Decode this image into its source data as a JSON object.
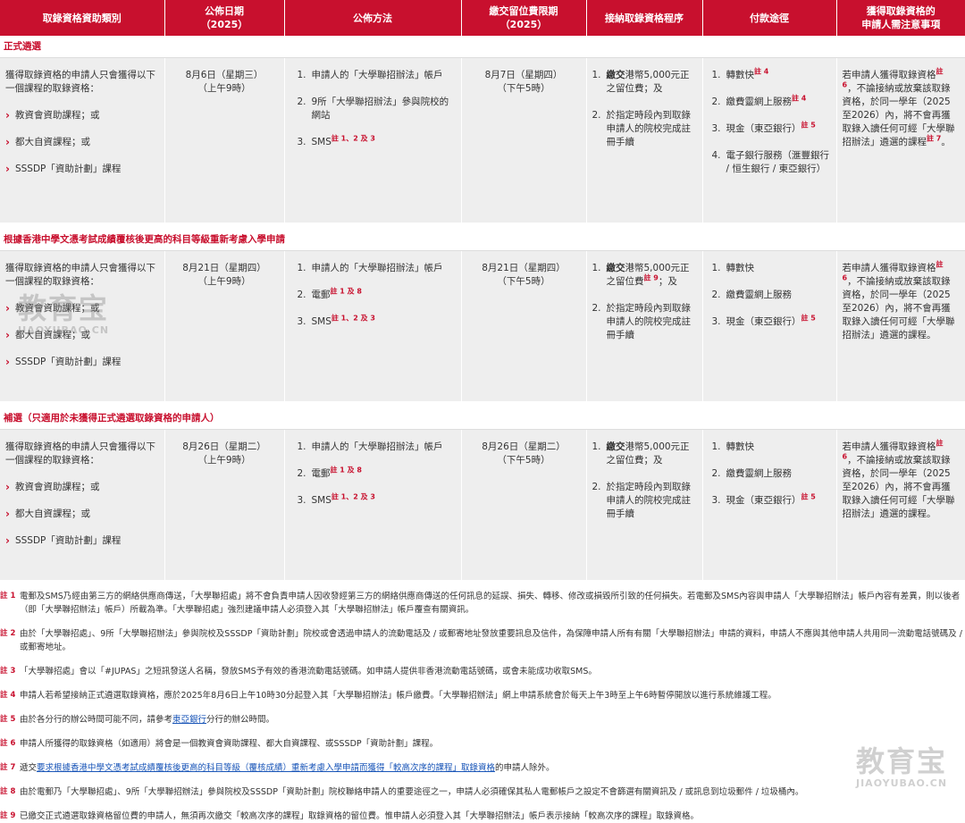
{
  "headers": [
    "取錄資格資助類別",
    "公佈日期\n（2025）",
    "公佈方法",
    "繳交留位費限期\n（2025）",
    "接納取錄資格程序",
    "付款途徑",
    "獲得取錄資格的\n申請人需注意事項"
  ],
  "sections": [
    {
      "title": "正式遴選",
      "eligibility_intro": "獲得取錄資格的申請人只會獲得以下一個課程的取錄資格：",
      "eligibility_items": [
        "教資會資助課程；或",
        "都大自資課程；或",
        "SSSDP「資助計劃」課程"
      ],
      "announce_date": "8月6日（星期三）",
      "announce_time": "（上午9時）",
      "methods": [
        {
          "text": "申請人的「大學聯招辦法」帳戶",
          "note": ""
        },
        {
          "text": "9所「大學聯招辦法」參與院校的網站",
          "note": ""
        },
        {
          "text": "SMS",
          "note": "註 1、2 及 3"
        }
      ],
      "deadline_date": "8月7日（星期四）",
      "deadline_time": "（下午5時）",
      "accept_steps": [
        {
          "pre": "繳交",
          "mid": "港幣5,000元正之留位費",
          "note": "",
          "post": "；及"
        },
        {
          "pre": "",
          "mid": "於指定時段內到取錄申請人的院校完成註冊手續",
          "note": "",
          "post": ""
        }
      ],
      "payments": [
        {
          "text": "轉數快",
          "note": "註 4"
        },
        {
          "text": "繳費靈網上服務",
          "note": "註 4"
        },
        {
          "text": "現金（東亞銀行）",
          "note": "註 5"
        },
        {
          "text": "電子銀行服務（滙豐銀行 / 恒生銀行 / 東亞銀行）",
          "note": ""
        }
      ],
      "notice_a": "若申請人獲得取錄資格",
      "notice_note1": "註 6",
      "notice_b": "，不論接納或放棄該取錄資格，於同一學年（2025至2026）內，將不會再獲取錄入讀任何可經「大學聯招辦法」遴選的課程",
      "notice_note2": "註 7",
      "notice_c": "。"
    },
    {
      "title": "根據香港中學文憑考試成績覆核後更高的科目等級重新考慮入學申請",
      "eligibility_intro": "獲得取錄資格的申請人只會獲得以下一個課程的取錄資格：",
      "eligibility_items": [
        "教資會資助課程；或",
        "都大自資課程；或",
        "SSSDP「資助計劃」課程"
      ],
      "announce_date": "8月21日（星期四）",
      "announce_time": "（上午9時）",
      "methods": [
        {
          "text": "申請人的「大學聯招辦法」帳戶",
          "note": ""
        },
        {
          "text": "電郵",
          "note": "註 1 及 8"
        },
        {
          "text": "SMS",
          "note": "註 1、2 及 3"
        }
      ],
      "deadline_date": "8月21日（星期四）",
      "deadline_time": "（下午5時）",
      "accept_steps": [
        {
          "pre": "繳交",
          "mid": "港幣5,000元正之留位費",
          "note": "註 9",
          "post": "；及"
        },
        {
          "pre": "",
          "mid": "於指定時段內到取錄申請人的院校完成註冊手續",
          "note": "",
          "post": ""
        }
      ],
      "payments": [
        {
          "text": "轉數快",
          "note": ""
        },
        {
          "text": "繳費靈網上服務",
          "note": ""
        },
        {
          "text": "現金（東亞銀行）",
          "note": "註 5"
        }
      ],
      "notice_a": "若申請人獲得取錄資格",
      "notice_note1": "註 6",
      "notice_b": "，不論接納或放棄該取錄資格，於同一學年（2025至2026）內，將不會再獲取錄入讀任何可經「大學聯招辦法」遴選的課程。",
      "notice_note2": "",
      "notice_c": ""
    },
    {
      "title": "補選（只適用於未獲得正式遴選取錄資格的申請人）",
      "eligibility_intro": "獲得取錄資格的申請人只會獲得以下一個課程的取錄資格：",
      "eligibility_items": [
        "教資會資助課程；或",
        "都大自資課程；或",
        "SSSDP「資助計劃」課程"
      ],
      "announce_date": "8月26日（星期二）",
      "announce_time": "（上午9時）",
      "methods": [
        {
          "text": "申請人的「大學聯招辦法」帳戶",
          "note": ""
        },
        {
          "text": "電郵",
          "note": "註 1 及 8"
        },
        {
          "text": "SMS",
          "note": "註 1、2 及 3"
        }
      ],
      "deadline_date": "8月26日（星期二）",
      "deadline_time": "（下午5時）",
      "accept_steps": [
        {
          "pre": "繳交",
          "mid": "港幣5,000元正之留位費",
          "note": "",
          "post": "；及"
        },
        {
          "pre": "",
          "mid": "於指定時段內到取錄申請人的院校完成註冊手續",
          "note": "",
          "post": ""
        }
      ],
      "payments": [
        {
          "text": "轉數快",
          "note": ""
        },
        {
          "text": "繳費靈網上服務",
          "note": ""
        },
        {
          "text": "現金（東亞銀行）",
          "note": "註 5"
        }
      ],
      "notice_a": "若申請人獲得取錄資格",
      "notice_note1": "註 6",
      "notice_b": "，不論接納或放棄該取錄資格，於同一學年（2025至2026）內，將不會再獲取錄入讀任何可經「大學聯招辦法」遴選的課程。",
      "notice_note2": "",
      "notice_c": ""
    }
  ],
  "notes": [
    {
      "label": "註 1",
      "text": "電郵及SMS乃經由第三方的網絡供應商傳送，「大學聯招處」將不會負責申請人因收發經第三方的網絡供應商傳送的任何訊息的延誤、損失、轉移、修改或損毀所引致的任何損失。若電郵及SMS內容與申請人「大學聯招辦法」帳戶內容有差異，則以後者（即「大學聯招辦法」帳戶）所載為準。「大學聯招處」強烈建議申請人必須登入其「大學聯招辦法」帳戶覆查有關資訊。"
    },
    {
      "label": "註 2",
      "text": "由於「大學聯招處」、9所「大學聯招辦法」參與院校及SSSDP「資助計劃」院校或會透過申請人的流動電話及 / 或郵寄地址發放重要訊息及信件，為保障申請人所有有關「大學聯招辦法」申請的資料，申請人不應與其他申請人共用同一流動電話號碼及 / 或郵寄地址。"
    },
    {
      "label": "註 3",
      "text": "「大學聯招處」會以「#JUPAS」之短訊發送人名稱，發放SMS予有效的香港流動電話號碼。如申請人提供非香港流動電話號碼，或會未能成功收取SMS。"
    },
    {
      "label": "註 4",
      "text": "申請人若希望接納正式遴選取錄資格，應於2025年8月6日上午10時30分起登入其「大學聯招辦法」帳戶繳費。「大學聯招辦法」網上申請系統會於每天上午3時至上午6時暫停開放以進行系統維護工程。"
    },
    {
      "label": "註 5",
      "text_a": "由於各分行的辦公時間可能不同，請參考",
      "link": "東亞銀行",
      "text_b": "分行的辦公時間。"
    },
    {
      "label": "註 6",
      "text": "申請人所獲得的取錄資格（如適用）將會是一個教資會資助課程、都大自資課程、或SSSDP「資助計劃」課程。"
    },
    {
      "label": "註 7",
      "text_a": "遞交",
      "link": "要求根據香港中學文憑考試成績覆核後更高的科目等級（覆核成績）重新考慮入學申請而獲得「較高次序的課程」取錄資格",
      "text_b": "的申請人除外。"
    },
    {
      "label": "註 8",
      "text": "由於電郵乃「大學聯招處」、9所「大學聯招辦法」參與院校及SSSDP「資助計劃」院校聯絡申請人的重要途徑之一，申請人必須確保其私人電郵帳戶之設定不會篩選有關資訊及 / 或訊息到垃圾郵件 / 垃圾桶內。"
    },
    {
      "label": "註 9",
      "text": "已繳交正式遴選取錄資格留位費的申請人，無須再次繳交「較高次序的課程」取錄資格的留位費。惟申請人必須登入其「大學聯招辦法」帳戶表示接納「較高次序的課程」取錄資格。"
    }
  ],
  "watermark": {
    "cn": "教育宝",
    "en": "JIAOYUBAO.CN"
  }
}
